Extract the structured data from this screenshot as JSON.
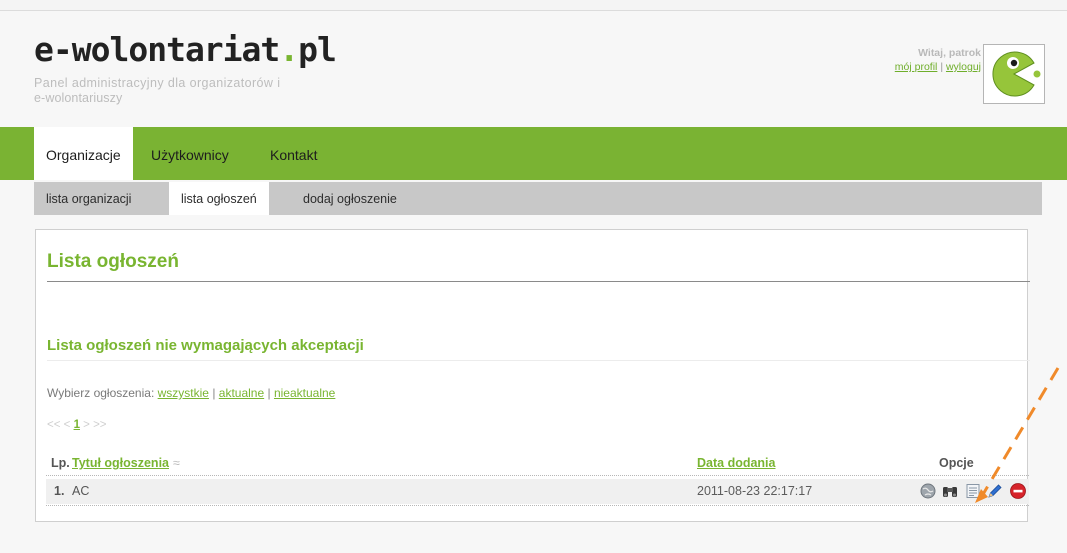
{
  "header": {
    "logo_main": "e-wolontariat",
    "logo_dot": ".",
    "logo_tld": "pl",
    "tagline_line1": "Panel administracyjny dla organizatorów i",
    "tagline_line2": "e-wolontariuszy",
    "greeting": "Witaj, patrok",
    "profile_link": "mój profil",
    "separator": "|",
    "logout_link": "wyloguj"
  },
  "main_nav": {
    "items": [
      "Organizacje",
      "Użytkownicy",
      "Kontakt"
    ],
    "active": "Organizacje"
  },
  "sub_nav": {
    "items": [
      "lista organizacji",
      "lista ogłoszeń",
      "dodaj ogłoszenie"
    ],
    "active": "lista ogłoszeń"
  },
  "page": {
    "title": "Lista ogłoszeń",
    "section_title": "Lista ogłoszeń nie wymagających akceptacji",
    "filter_label": "Wybierz ogłoszenia:",
    "filter_options": [
      "wszystkie",
      "aktualne",
      "nieaktualne"
    ],
    "filter_sep": "|",
    "pager": {
      "first": "<<",
      "prev": "<",
      "current": "1",
      "next": ">",
      "last": ">>"
    }
  },
  "table": {
    "headers": {
      "lp": "Lp.",
      "title": "Tytuł ogłoszenia",
      "sort_indicator": "≈",
      "date": "Data dodania",
      "options": "Opcje"
    },
    "rows": [
      {
        "lp": "1.",
        "title": "AC",
        "date": "2011-08-23 22:17:17"
      }
    ],
    "row_action_icons": [
      "globe-icon",
      "binoculars-icon",
      "document-icon",
      "pencil-icon",
      "delete-icon"
    ]
  },
  "colors": {
    "brand_green": "#79b531",
    "nav_green": "#7ab333",
    "annotation_orange": "#f08a2a",
    "delete_red": "#d6232a"
  }
}
